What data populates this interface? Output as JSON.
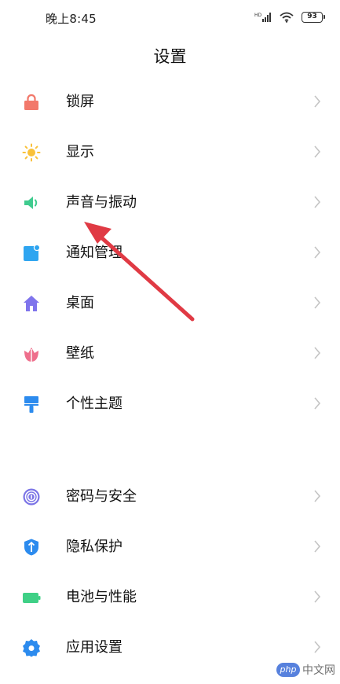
{
  "status_bar": {
    "time": "晚上8:45",
    "battery": "93",
    "icons": [
      "hd-signal-icon",
      "signal-icon",
      "wifi-icon",
      "battery-icon"
    ]
  },
  "header": {
    "title": "设置"
  },
  "settings": {
    "group1": [
      {
        "label": "锁屏",
        "icon": "lock-icon",
        "color": "#F2786A"
      },
      {
        "label": "显示",
        "icon": "sun-icon",
        "color": "#F9C13A"
      },
      {
        "label": "声音与振动",
        "icon": "speaker-icon",
        "color": "#3FCB8E"
      },
      {
        "label": "通知管理",
        "icon": "notification-icon",
        "color": "#2FA5F0"
      },
      {
        "label": "桌面",
        "icon": "home-icon",
        "color": "#7F74EC"
      },
      {
        "label": "壁纸",
        "icon": "tulip-icon",
        "color": "#EE6F8C"
      },
      {
        "label": "个性主题",
        "icon": "brush-icon",
        "color": "#2C8BEE"
      }
    ],
    "group2": [
      {
        "label": "密码与安全",
        "icon": "fingerprint-icon",
        "color": "#7B74E6"
      },
      {
        "label": "隐私保护",
        "icon": "privacy-icon",
        "color": "#2C8BEE"
      },
      {
        "label": "电池与性能",
        "icon": "battery-icon",
        "color": "#3FD086"
      },
      {
        "label": "应用设置",
        "icon": "gear-icon",
        "color": "#2C8BEE"
      }
    ]
  },
  "annotation": {
    "arrow_color": "#E03A44"
  },
  "watermark": {
    "badge": "php",
    "text": "中文网"
  }
}
